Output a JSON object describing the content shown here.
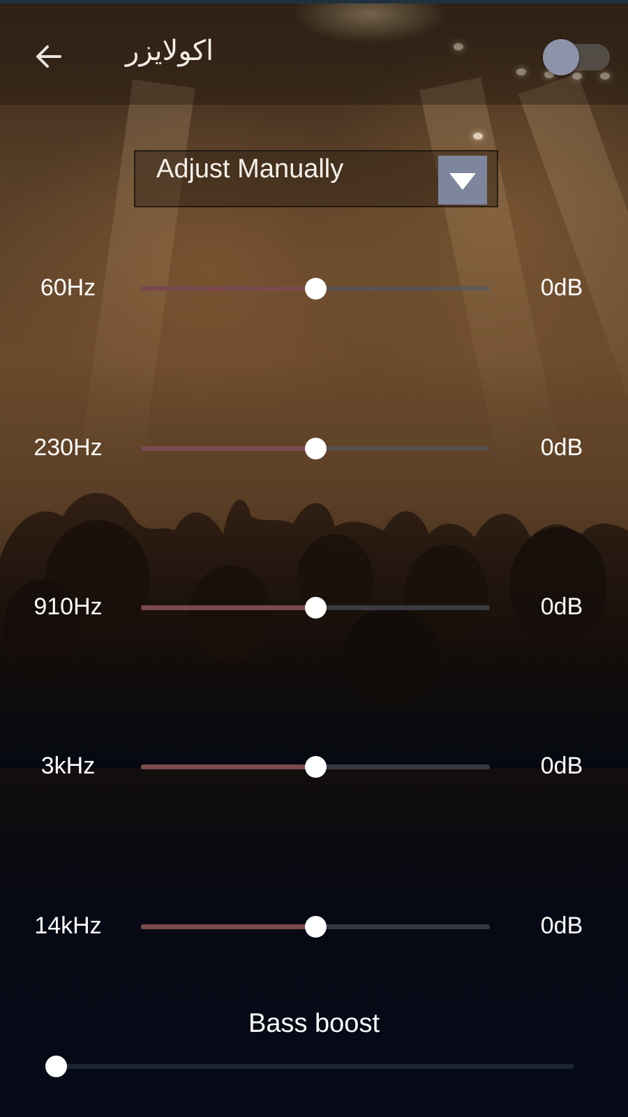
{
  "header": {
    "back_icon": "arrow-left-icon",
    "title": "اکولایزر",
    "toggle_on": false
  },
  "preset_dropdown": {
    "selected": "Adjust Manually",
    "arrow_icon": "triangle-down-icon"
  },
  "bands": [
    {
      "freq": "60Hz",
      "gain": "0dB",
      "level": 0.5
    },
    {
      "freq": "230Hz",
      "gain": "0dB",
      "level": 0.5
    },
    {
      "freq": "910Hz",
      "gain": "0dB",
      "level": 0.5
    },
    {
      "freq": "3kHz",
      "gain": "0dB",
      "level": 0.5
    },
    {
      "freq": "14kHz",
      "gain": "0dB",
      "level": 0.5
    }
  ],
  "bass_boost": {
    "label": "Bass boost",
    "level": 0
  },
  "colors": {
    "slider_fill": "#7a4a4c",
    "dropdown_arrow_bg": "#7d869c",
    "toggle_knob": "#8d93a8"
  }
}
